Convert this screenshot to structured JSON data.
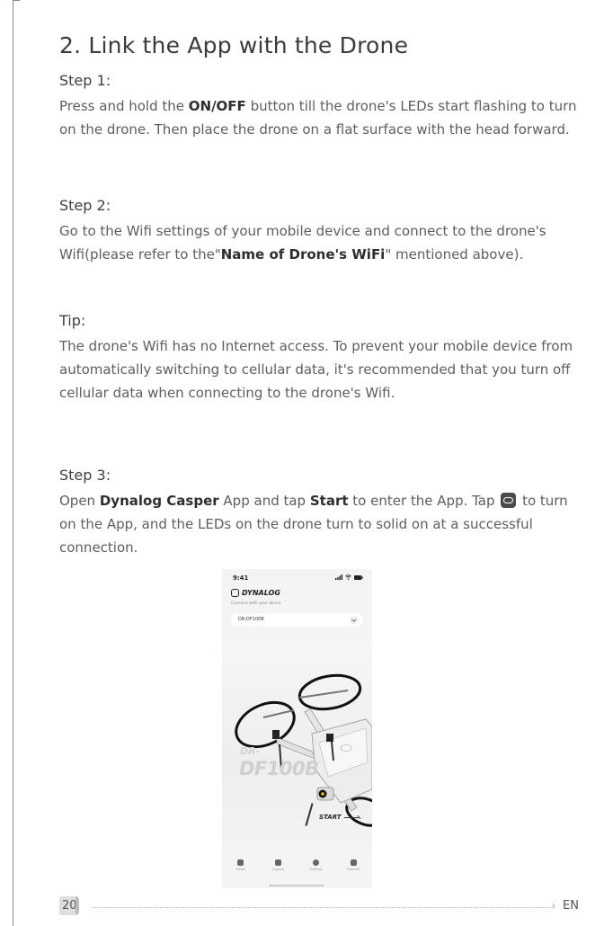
{
  "section": {
    "title": "2. Link the App with the Drone"
  },
  "step1": {
    "heading": "Step 1:",
    "text_before": "Press and hold the ",
    "bold": "ON/OFF",
    "text_after": " button till the drone's LEDs start flashing to turn on the drone. Then place the drone on a flat surface with the head forward."
  },
  "step2": {
    "heading": "Step 2:",
    "text_before": "Go to the Wifi settings of your mobile device and connect to the drone's Wifi(please refer to the\"",
    "bold": "Name of Drone's WiFi",
    "text_after": "\" mentioned above)."
  },
  "tip": {
    "heading": "Tip:",
    "text": "The drone's Wifi has no Internet access. To prevent your mobile device from automatically switching to cellular data, it's recommended that you turn off cellular data when connecting to the drone's Wifi."
  },
  "step3": {
    "heading": "Step 3:",
    "text_1": "Open ",
    "app_name": "Dynalog Casper",
    "text_2": " App and tap ",
    "start_word": "Start",
    "text_3": " to enter the App. Tap ",
    "icon": "gamepad-icon",
    "text_4": " to turn on the App, and the LEDs on the drone turn to solid on at a successful connection."
  },
  "phone": {
    "time": "9:41",
    "brand": "DYNALOG",
    "subtitle": "Connect with your drone",
    "selected_drone": "DR-DF100B",
    "model_prefix": "DR-",
    "model_name": "DF100B",
    "start_label": "START",
    "tabs": [
      {
        "label": "Media",
        "icon": "media-icon"
      },
      {
        "label": "Support",
        "icon": "support-icon"
      },
      {
        "label": "Settings",
        "icon": "settings-icon"
      },
      {
        "label": "Tutorials",
        "icon": "tutorials-icon"
      }
    ]
  },
  "footer": {
    "page_number": "20",
    "language": "EN"
  }
}
